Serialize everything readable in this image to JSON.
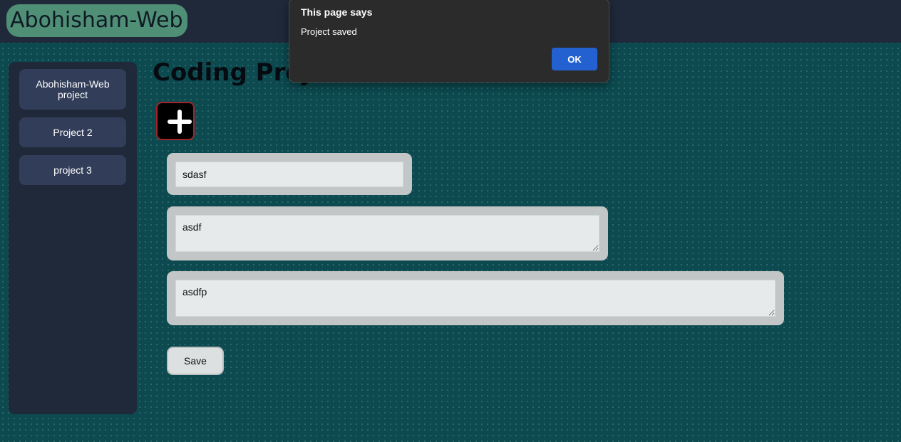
{
  "header": {
    "brand": "Abohisham-Web",
    "brand_color": "#4f8f76",
    "background_color": "#1f293a"
  },
  "sidebar": {
    "items": [
      {
        "label": "Abohisham-Web project"
      },
      {
        "label": "Project 2"
      },
      {
        "label": "project 3"
      }
    ]
  },
  "main": {
    "title": "Coding Proj",
    "add_button_icon": "plus-icon",
    "fields": {
      "title_value": "sdasf",
      "description_value": "asdf",
      "notes_value": "asdfp"
    },
    "save_label": "Save"
  },
  "dialog": {
    "title": "This page says",
    "message": "Project saved",
    "ok_label": "OK",
    "ok_color": "#2461d0"
  },
  "colors": {
    "page_background": "#0c4a50",
    "add_button_border": "#a3242d"
  }
}
